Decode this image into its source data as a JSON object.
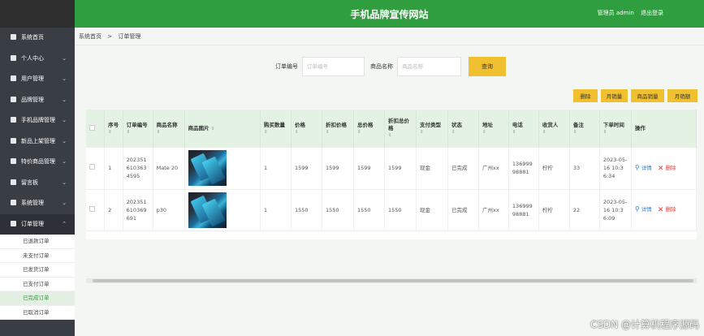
{
  "header": {
    "title": "手机品牌宣传网站",
    "user_label": "管理员 admin",
    "logout": "退出登录"
  },
  "sidebar": {
    "items": [
      {
        "label": "系统首页",
        "icon": "home-icon",
        "chevron": ""
      },
      {
        "label": "个人中心",
        "icon": "user-icon",
        "chevron": "⌄"
      },
      {
        "label": "用户管理",
        "icon": "users-icon",
        "chevron": "⌄"
      },
      {
        "label": "品牌管理",
        "icon": "brand-icon",
        "chevron": "⌄"
      },
      {
        "label": "手机品牌管理",
        "icon": "sliders-icon",
        "chevron": "⌄"
      },
      {
        "label": "新品上架管理",
        "icon": "grid-icon",
        "chevron": "⌄"
      },
      {
        "label": "特价商品管理",
        "icon": "grid-icon",
        "chevron": "⌄"
      },
      {
        "label": "留言板",
        "icon": "grid-icon",
        "chevron": "⌄"
      },
      {
        "label": "系统管理",
        "icon": "shield-icon",
        "chevron": "⌄"
      },
      {
        "label": "订单管理",
        "icon": "chart-icon",
        "chevron": "⌃"
      }
    ],
    "submenu": [
      {
        "label": "已退款订单"
      },
      {
        "label": "未支付订单"
      },
      {
        "label": "已发货订单"
      },
      {
        "label": "已支付订单"
      },
      {
        "label": "已完成订单"
      },
      {
        "label": "已取消订单"
      }
    ]
  },
  "breadcrumb": {
    "home": "系统首页",
    "sep": ">",
    "current": "订单管理"
  },
  "search": {
    "order_label": "订单编号",
    "order_placeholder": "订单编号",
    "product_label": "商品名称",
    "product_placeholder": "商品名称",
    "button": "查询"
  },
  "actions": {
    "delete": "删除",
    "monthly_sales": "月销量",
    "product_sales": "商品销量",
    "monthly_revenue": "月销额"
  },
  "table": {
    "sort_glyph": "⇕",
    "columns": [
      "序号",
      "订单编号",
      "商品名称",
      "商品图片",
      "购买数量",
      "价格",
      "折扣价格",
      "总价格",
      "折扣总价格",
      "支付类型",
      "状态",
      "地址",
      "电话",
      "收货人",
      "备注",
      "下单时间",
      "操作"
    ],
    "rows": [
      {
        "index": "1",
        "order_no": "2023516103634595",
        "product": "Mate 20",
        "qty": "1",
        "price": "1599",
        "discount_price": "1599",
        "total": "1599",
        "discount_total": "1599",
        "pay_type": "现金",
        "status": "已完成",
        "address": "广州xx",
        "phone": "13699998881",
        "receiver": "柠柠",
        "remark": "33",
        "time": "2023-05-16 10:36:34"
      },
      {
        "index": "2",
        "order_no": "202351610369691",
        "product": "p30",
        "qty": "1",
        "price": "1550",
        "discount_price": "1550",
        "total": "1550",
        "discount_total": "1550",
        "pay_type": "现金",
        "status": "已完成",
        "address": "广州xx",
        "phone": "13699998881",
        "receiver": "柠柠",
        "remark": "22",
        "time": "2023-05-16 10:36:09"
      }
    ],
    "op_view": "详情",
    "op_delete": "删除"
  },
  "watermark": "CSDN @计算机程序源码"
}
